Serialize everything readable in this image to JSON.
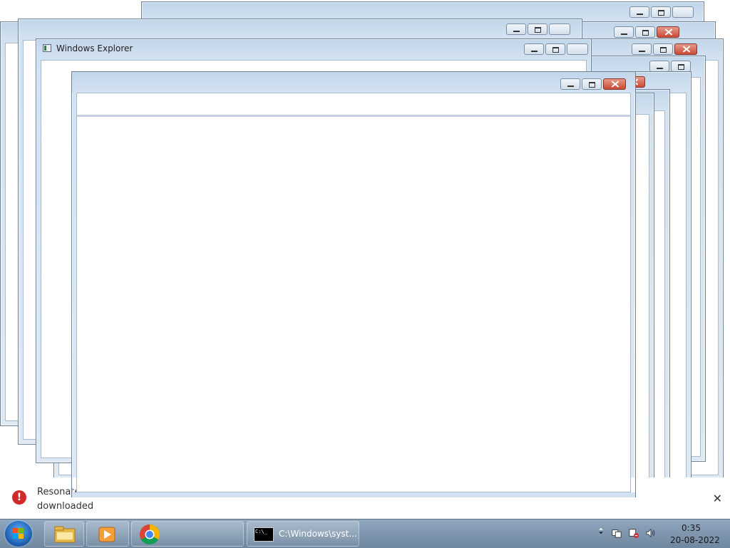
{
  "windows": {
    "explorer_title": "Windows Explorer"
  },
  "notification": {
    "line1": "Resonate",
    "line2": "downloaded",
    "close_glyph": "✕",
    "error_glyph": "!"
  },
  "taskbar": {
    "pinned": [
      {
        "name": "Windows Explorer",
        "icon": "folder-icon"
      },
      {
        "name": "Media Player",
        "icon": "media-player-icon"
      },
      {
        "name": "Google Chrome",
        "icon": "chrome-icon"
      }
    ],
    "running": {
      "label": "C:\\Windows\\syst...",
      "icon": "command-prompt-icon",
      "icon_text": "C:\\_"
    },
    "tray": {
      "icons": [
        "show-hidden-icons",
        "action-center-icon",
        "network-icon",
        "volume-icon"
      ]
    },
    "clock": {
      "time": "0:35",
      "date": "20-08-2022"
    }
  },
  "colors": {
    "window_frame": "#c2d6ea",
    "close_button": "#c84a36",
    "taskbar": "#7f97af",
    "error_badge": "#d22a2a"
  }
}
